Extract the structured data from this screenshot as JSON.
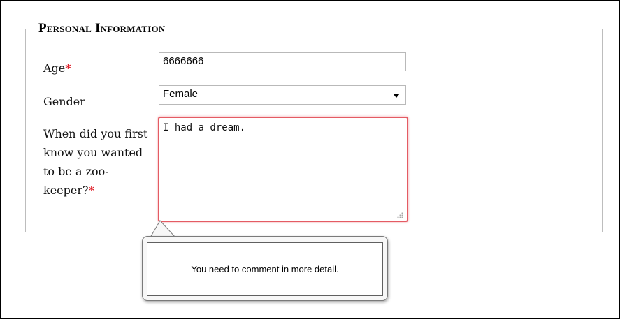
{
  "form": {
    "section_title": "Personal Information",
    "required_marker": "*",
    "age": {
      "label": "Age",
      "value": "6666666",
      "required": true
    },
    "gender": {
      "label": "Gender",
      "selected": "Female"
    },
    "question": {
      "label": "When did you first know you wanted to be a zoo-keeper?",
      "value": "I had a dream.",
      "required": true
    }
  },
  "validation": {
    "message": "You need to comment in more detail."
  },
  "colors": {
    "required": "#e0202a",
    "error_border": "#e45b63"
  },
  "icons": {
    "select_arrow": "chevron-down-icon",
    "resize": "resize-grip-icon"
  }
}
